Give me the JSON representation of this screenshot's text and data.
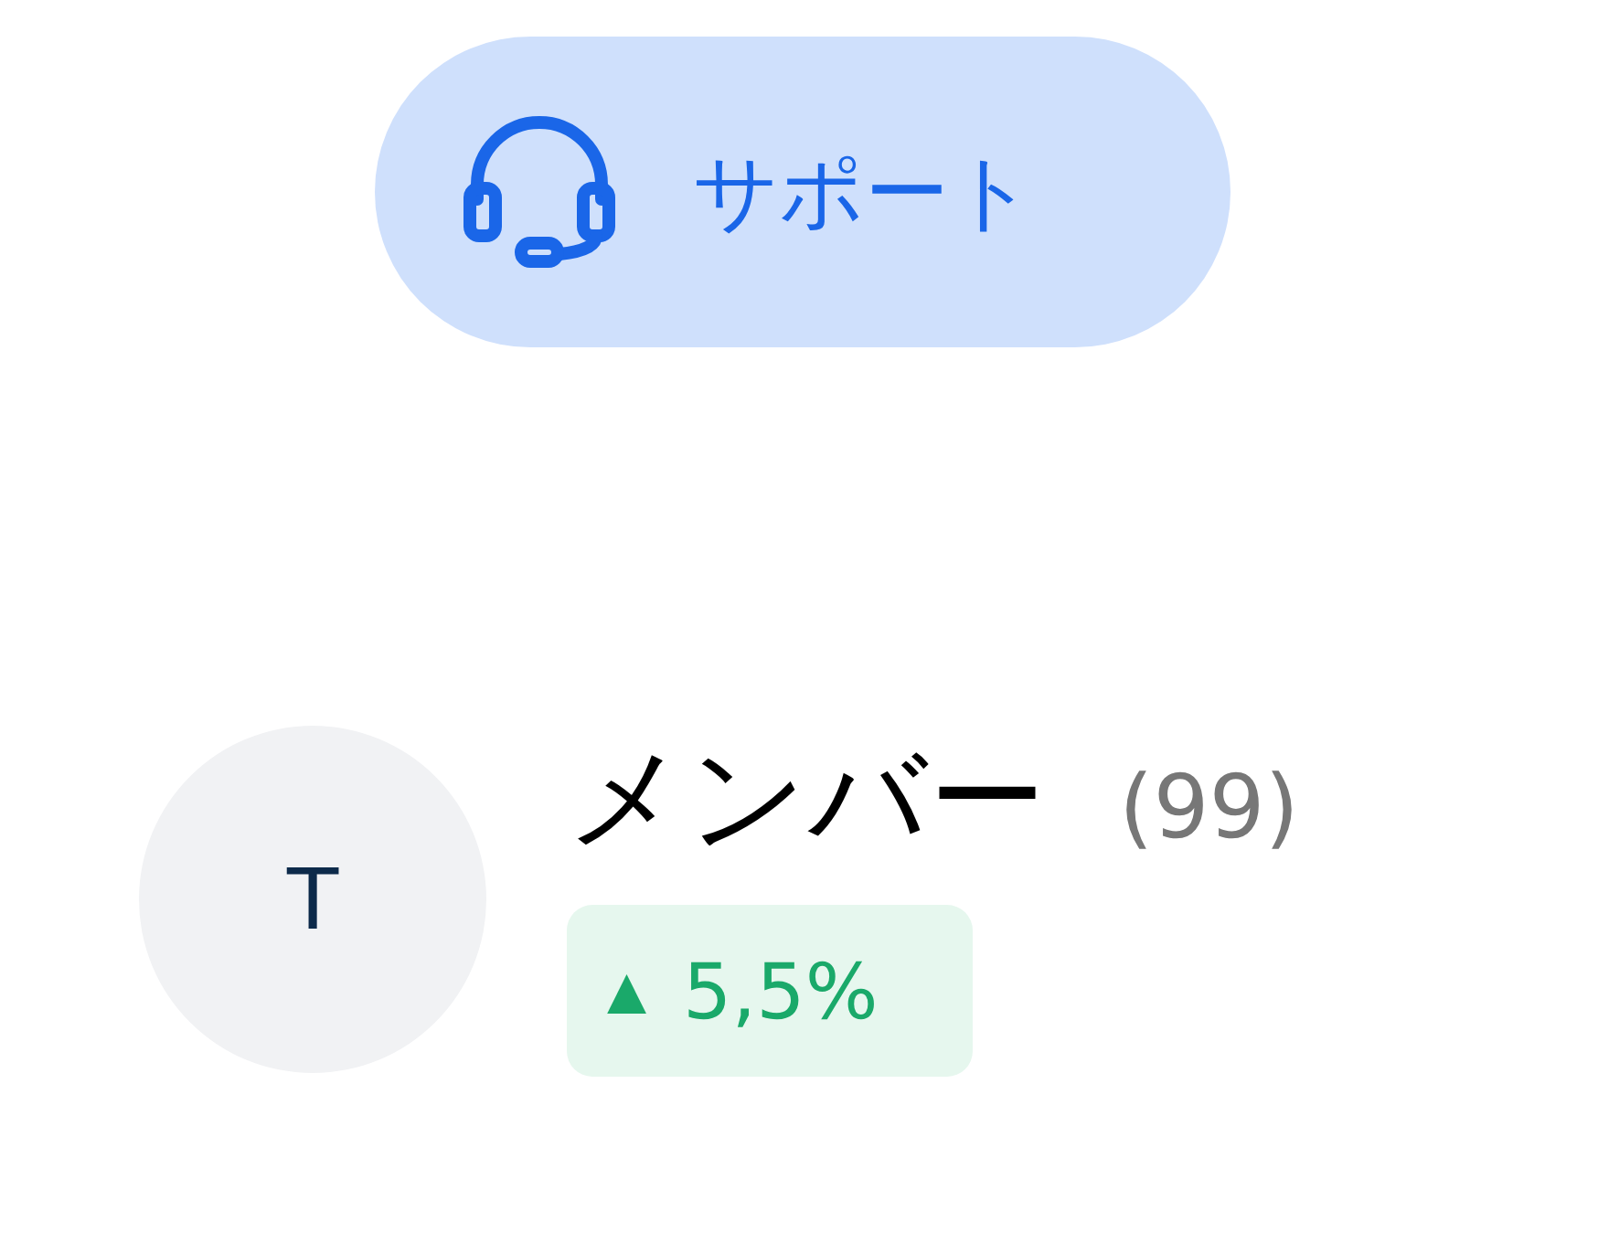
{
  "support_button": {
    "label": "サポート"
  },
  "member": {
    "avatar_initial": "T",
    "title": "メンバー",
    "count": "(99)",
    "change": {
      "arrow": "▲",
      "value": "5,5%"
    }
  }
}
